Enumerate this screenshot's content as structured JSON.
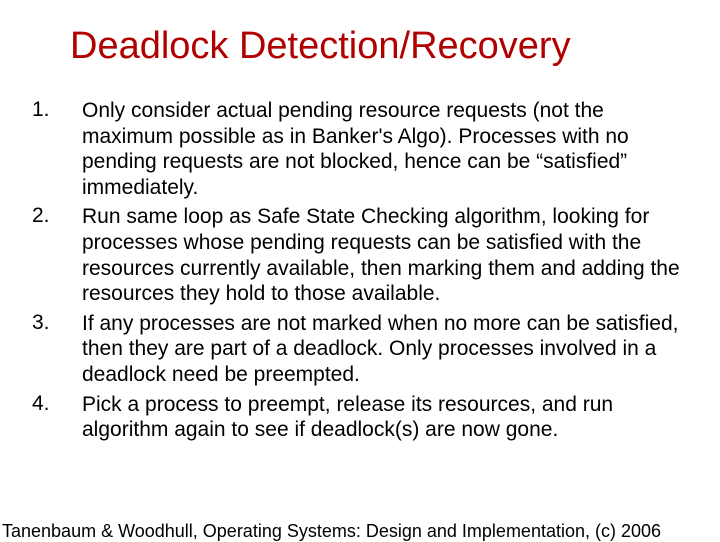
{
  "title": "Deadlock Detection/Recovery",
  "items": [
    {
      "n": "1.",
      "t": "Only consider actual pending resource requests (not the maximum possible as in Banker's Algo). Processes with no pending requests are not blocked, hence can be “satisfied” immediately."
    },
    {
      "n": "2.",
      "t": "Run same loop as Safe State Checking algorithm, looking for processes whose pending requests can be satisfied with the resources currently available, then marking them and adding the resources they hold to those available."
    },
    {
      "n": "3.",
      "t": "If any processes are not marked when no more can be satisfied, then they are part of a deadlock. Only processes involved in a deadlock need be preempted."
    },
    {
      "n": "4.",
      "t": "Pick a process to preempt, release its resources, and run algorithm again to see if deadlock(s) are now gone."
    }
  ],
  "footer": "Tanenbaum & Woodhull, Operating Systems: Design and Implementation, (c) 2006"
}
